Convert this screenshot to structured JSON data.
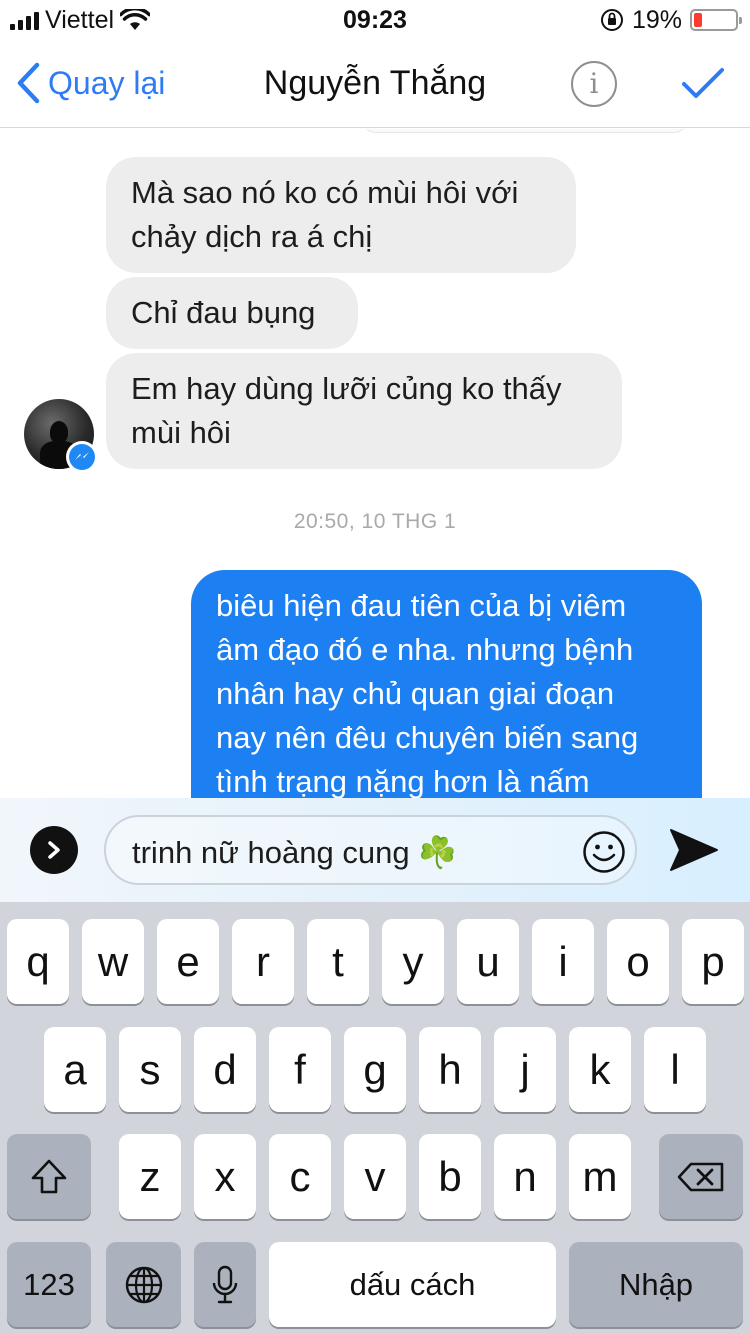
{
  "status_bar": {
    "carrier": "Viettel",
    "time": "09:23",
    "battery": "19%",
    "battery_level": 0.19
  },
  "nav": {
    "back_label": "Quay lại",
    "title": "Nguyễn Thắng",
    "info_label": "i"
  },
  "messages": {
    "incoming": [
      {
        "lines": [
          "Mà sao nó ko có mùi hôi với",
          "chảy dịch ra á chị"
        ]
      },
      {
        "lines": [
          "Chỉ đau bụng"
        ]
      },
      {
        "lines": [
          "Em hay dùng lưỡi củng ko thấy",
          "mùi hôi"
        ]
      }
    ],
    "timestamp": "20:50, 10 THG 1",
    "outgoing": [
      {
        "lines": [
          "biêu hiện đau tiên của bị viêm",
          "âm đạo đó e nha. nhưng bệnh",
          "nhân hay chủ quan giai đoạn",
          "nay nên đêu chuyên biến sang",
          "tình trạng nặng hơn là nấm"
        ]
      }
    ]
  },
  "composer": {
    "text": "trinh nữ hoàng cung",
    "text_emoji": "☘️",
    "emoji_icon": "smiley-icon",
    "send_icon": "send-arrow-icon",
    "expand_icon": "chevron-right-icon"
  },
  "keyboard": {
    "row1": [
      "q",
      "w",
      "e",
      "r",
      "t",
      "y",
      "u",
      "i",
      "o",
      "p"
    ],
    "row2": [
      "a",
      "s",
      "d",
      "f",
      "g",
      "h",
      "j",
      "k",
      "l"
    ],
    "row3": [
      "z",
      "x",
      "c",
      "v",
      "b",
      "n",
      "m"
    ],
    "numbers_label": "123",
    "space_label": "dấu cách",
    "return_label": "Nhập",
    "shift_icon": "shift-icon",
    "delete_icon": "backspace-icon",
    "globe_icon": "globe-icon",
    "mic_icon": "microphone-icon"
  }
}
